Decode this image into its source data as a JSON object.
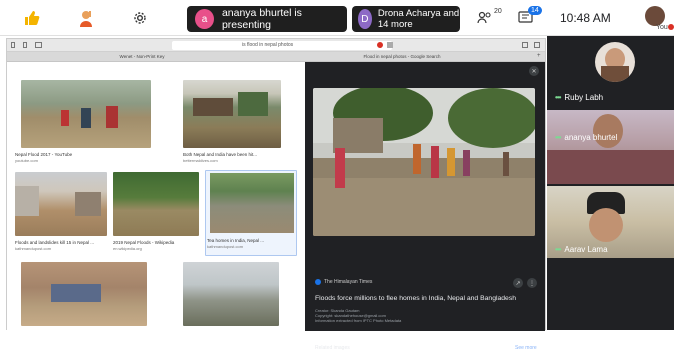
{
  "toolbar": {
    "presenter_initial": "a",
    "presenter_text": "ananya bhurtel is presenting",
    "other_initial": "D",
    "other_text": "Drona Acharya and 14 more",
    "participant_count": "20",
    "chat_badge": "14",
    "time": "10:48 AM",
    "you_label": "You"
  },
  "browser": {
    "url": "is flood in nepal photos",
    "tabs": [
      "Wenet - Non-Print Key",
      "Flood in nepal photos - Google Search"
    ]
  },
  "gallery": {
    "items": [
      {
        "caption": "Nepal Flood 2017 - YouTube",
        "source": "youtube.com"
      },
      {
        "caption": "Both Nepal and India have been hit...",
        "source": "bettermaldives.com"
      },
      {
        "caption": "Floods and landslides kill 15 in Nepal ...",
        "source": "kathmandupost.com"
      },
      {
        "caption": "2019 Nepal Floods - Wikipedia",
        "source": "en.wikipedia.org"
      },
      {
        "caption": "Tea homes in India, Nepal ...",
        "source": "kathmandupost.com"
      }
    ]
  },
  "preview": {
    "source_name": "The Himalayan Times",
    "title": "Floods force millions to flee homes in India, Nepal and Bangladesh",
    "meta_lines": [
      "Creator: Skanda Gautam",
      "Copyright: skandathehouse@gmail.com",
      "Information extracted from IPTC Photo Metadata"
    ],
    "related_label": "Related images",
    "see_more": "See more"
  },
  "participants": [
    {
      "name": "Ruby Labh"
    },
    {
      "name": "ananya bhurtel"
    },
    {
      "name": "Aarav Lama"
    }
  ]
}
